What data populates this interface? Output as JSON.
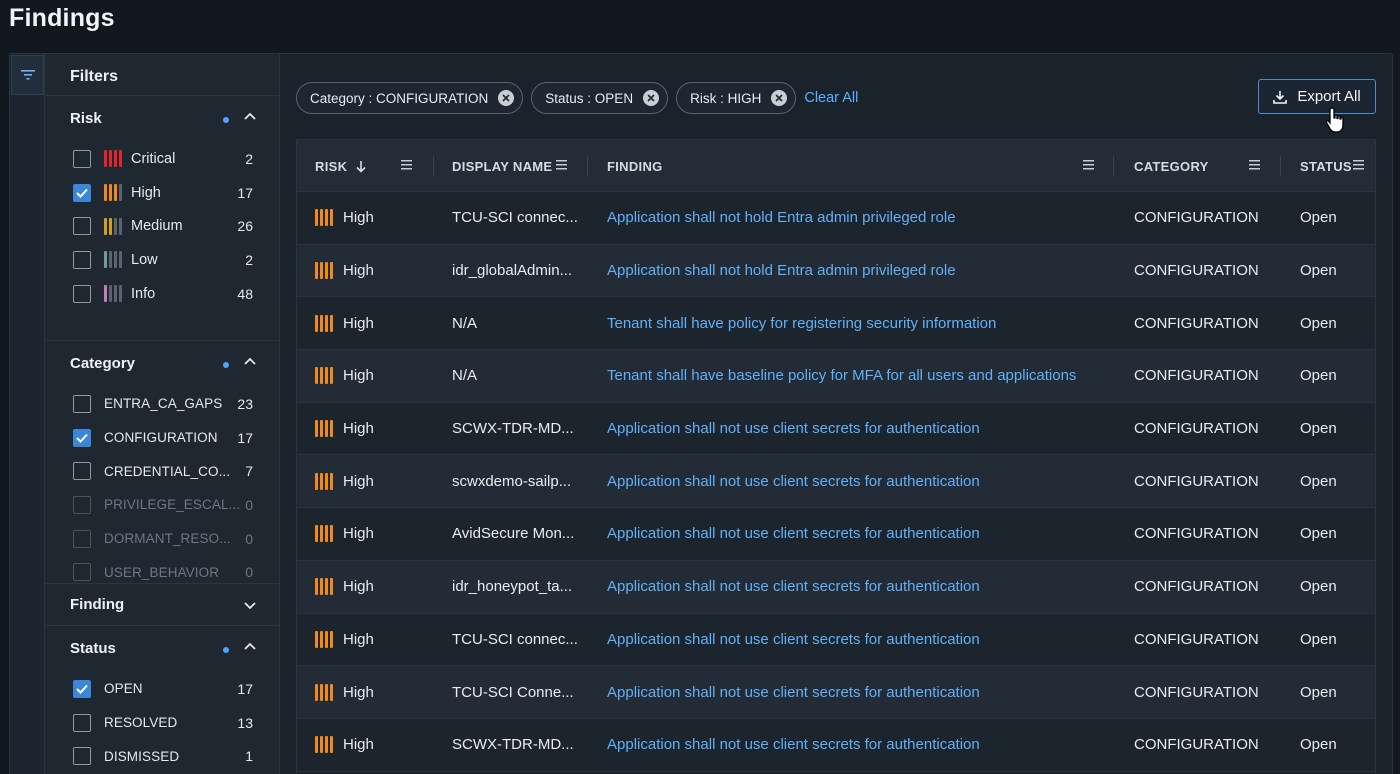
{
  "page": {
    "title": "Findings"
  },
  "filters": {
    "title": "Filters",
    "risk": {
      "label": "Risk",
      "options": [
        {
          "label": "Critical",
          "count": "2",
          "checked": false,
          "colors": [
            "#e0262a",
            "#e0262a",
            "#e0262a",
            "#e0262a"
          ]
        },
        {
          "label": "High",
          "count": "17",
          "checked": true,
          "colors": [
            "#f08a1c",
            "#f08a1c",
            "#f08a1c",
            "#5a636e"
          ]
        },
        {
          "label": "Medium",
          "count": "26",
          "checked": false,
          "colors": [
            "#d4a017",
            "#d4a017",
            "#5a636e",
            "#5a636e"
          ]
        },
        {
          "label": "Low",
          "count": "2",
          "checked": false,
          "colors": [
            "#6f9c9c",
            "#5a636e",
            "#5a636e",
            "#5a636e"
          ]
        },
        {
          "label": "Info",
          "count": "48",
          "checked": false,
          "colors": [
            "#c97bb8",
            "#5a636e",
            "#5a636e",
            "#5a636e"
          ]
        }
      ]
    },
    "category": {
      "label": "Category",
      "options": [
        {
          "label": "ENTRA_CA_GAPS",
          "count": "23",
          "checked": false,
          "disabled": false
        },
        {
          "label": "CONFIGURATION",
          "count": "17",
          "checked": true,
          "disabled": false
        },
        {
          "label": "CREDENTIAL_CO...",
          "count": "7",
          "checked": false,
          "disabled": false
        },
        {
          "label": "PRIVILEGE_ESCAL...",
          "count": "0",
          "checked": false,
          "disabled": true
        },
        {
          "label": "DORMANT_RESO...",
          "count": "0",
          "checked": false,
          "disabled": true
        },
        {
          "label": "USER_BEHAVIOR",
          "count": "0",
          "checked": false,
          "disabled": true
        }
      ]
    },
    "finding": {
      "label": "Finding"
    },
    "status": {
      "label": "Status",
      "options": [
        {
          "label": "OPEN",
          "count": "17",
          "checked": true
        },
        {
          "label": "RESOLVED",
          "count": "13",
          "checked": false
        },
        {
          "label": "DISMISSED",
          "count": "1",
          "checked": false
        }
      ]
    }
  },
  "chips": [
    {
      "label": "Category : CONFIGURATION"
    },
    {
      "label": "Status : OPEN"
    },
    {
      "label": "Risk : HIGH"
    }
  ],
  "clear_all": "Clear All",
  "export_label": "Export All",
  "table": {
    "headers": {
      "risk": "RISK",
      "display_name": "DISPLAY NAME",
      "finding": "FINDING",
      "category": "CATEGORY",
      "status": "STATUS"
    },
    "rows": [
      {
        "risk": "High",
        "display_name": "TCU-SCI connec...",
        "finding": "Application shall not hold Entra admin privileged role",
        "category": "CONFIGURATION",
        "status": "Open"
      },
      {
        "risk": "High",
        "display_name": "idr_globalAdmin...",
        "finding": "Application shall not hold Entra admin privileged role",
        "category": "CONFIGURATION",
        "status": "Open"
      },
      {
        "risk": "High",
        "display_name": "N/A",
        "finding": "Tenant shall have policy for registering security information",
        "category": "CONFIGURATION",
        "status": "Open"
      },
      {
        "risk": "High",
        "display_name": "N/A",
        "finding": "Tenant shall have baseline policy for MFA for all users and applications",
        "category": "CONFIGURATION",
        "status": "Open"
      },
      {
        "risk": "High",
        "display_name": "SCWX-TDR-MD...",
        "finding": "Application shall not use client secrets for authentication",
        "category": "CONFIGURATION",
        "status": "Open"
      },
      {
        "risk": "High",
        "display_name": "scwxdemo-sailp...",
        "finding": "Application shall not use client secrets for authentication",
        "category": "CONFIGURATION",
        "status": "Open"
      },
      {
        "risk": "High",
        "display_name": "AvidSecure Mon...",
        "finding": "Application shall not use client secrets for authentication",
        "category": "CONFIGURATION",
        "status": "Open"
      },
      {
        "risk": "High",
        "display_name": "idr_honeypot_ta...",
        "finding": "Application shall not use client secrets for authentication",
        "category": "CONFIGURATION",
        "status": "Open"
      },
      {
        "risk": "High",
        "display_name": "TCU-SCI connec...",
        "finding": "Application shall not use client secrets for authentication",
        "category": "CONFIGURATION",
        "status": "Open"
      },
      {
        "risk": "High",
        "display_name": "TCU-SCI Conne...",
        "finding": "Application shall not use client secrets for authentication",
        "category": "CONFIGURATION",
        "status": "Open"
      },
      {
        "risk": "High",
        "display_name": "SCWX-TDR-MD...",
        "finding": "Application shall not use client secrets for authentication",
        "category": "CONFIGURATION",
        "status": "Open"
      }
    ]
  }
}
